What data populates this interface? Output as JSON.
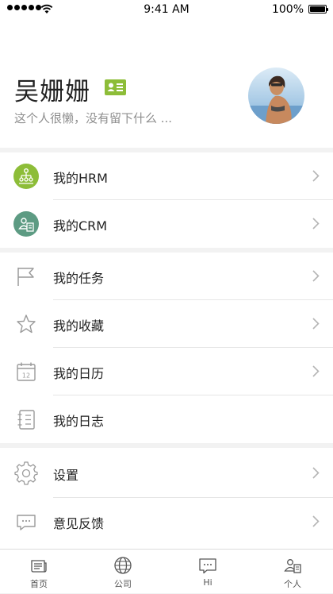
{
  "status_bar": {
    "time": "9:41 AM",
    "battery": "100%"
  },
  "profile": {
    "name": "吴姗姗",
    "signature": "这个人很懒，没有留下什么 ..."
  },
  "menu": {
    "group1": [
      {
        "label": "我的HRM"
      },
      {
        "label": "我的CRM"
      }
    ],
    "group2": [
      {
        "label": "我的任务"
      },
      {
        "label": "我的收藏"
      },
      {
        "label": "我的日历"
      },
      {
        "label": "我的日志"
      }
    ],
    "group3": [
      {
        "label": "设置"
      },
      {
        "label": "意见反馈"
      }
    ]
  },
  "calendar_icon_day": "12",
  "tab_bar": [
    {
      "label": "首页"
    },
    {
      "label": "公司"
    },
    {
      "label": "Hi"
    },
    {
      "label": "个人"
    }
  ],
  "colors": {
    "accent_green": "#8dbd38",
    "crm_teal": "#5d9b83",
    "icon_gray": "#9a9a9a"
  }
}
